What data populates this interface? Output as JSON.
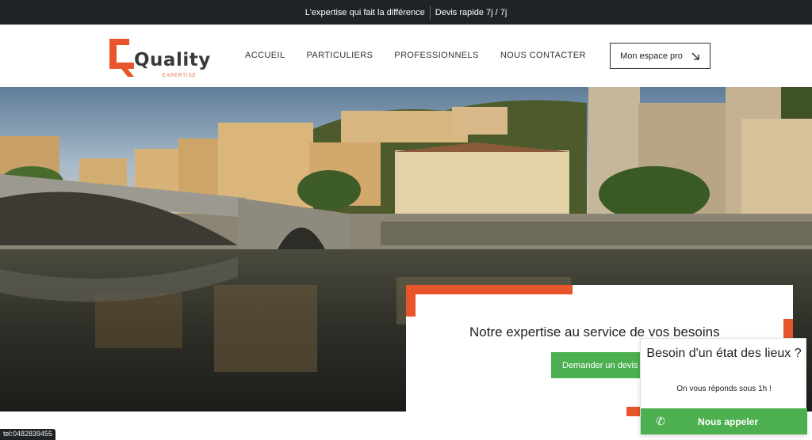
{
  "topbar": {
    "tagline": "L'expertise qui fait la différence",
    "quote": "Devis rapide 7j / 7j"
  },
  "logo": {
    "word": "Quality",
    "sub": "EXPERTISE"
  },
  "nav": {
    "items": [
      "ACCUEIL",
      "PARTICULIERS",
      "PROFESSIONNELS",
      "NOUS CONTACTER"
    ]
  },
  "header": {
    "pro_button": "Mon espace pro",
    "pro_icon": "arrow-down-right-icon"
  },
  "card": {
    "title": "Notre expertise au service de vos besoins",
    "button": "Demander un devis"
  },
  "popup": {
    "title": "Besoin d'un état des lieux ?",
    "subtitle": "On vous réponds sous 1h !",
    "call_label": "Nous appeler",
    "call_icon": "phone-icon"
  },
  "status": {
    "tel": "tel:0482839455"
  },
  "colors": {
    "accent": "#e8552a",
    "green": "#4caf50",
    "dark": "#1f2326"
  }
}
